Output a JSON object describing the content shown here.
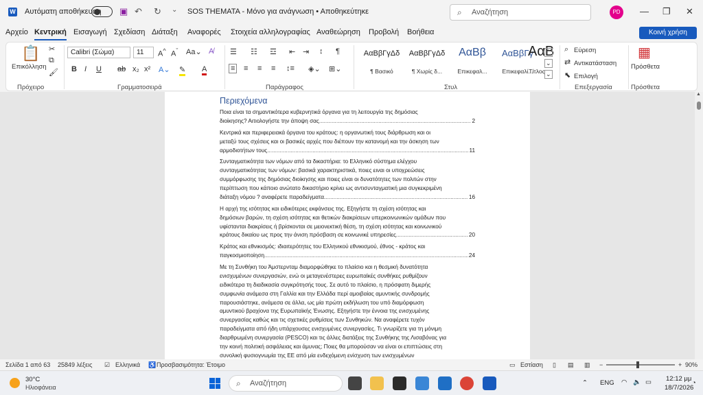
{
  "titlebar": {
    "app_icon": "W",
    "autosave_label": "Αυτόματη αποθήκευση",
    "doc_title": "SOS THEMATA  -  Μόνο για ανάγνωση  •  Αποθηκεύτηκε",
    "search_placeholder": "Αναζήτηση",
    "avatar_initials": "PD"
  },
  "menu": {
    "tabs": [
      "Αρχείο",
      "Κεντρική",
      "Εισαγωγή",
      "Σχεδίαση",
      "Διάταξη",
      "Αναφορές",
      "Στοιχεία αλληλογραφίας",
      "Αναθεώρηση",
      "Προβολή",
      "Βοήθεια"
    ],
    "share_label": "Κοινή χρήση"
  },
  "ribbon": {
    "paste_label": "Επικόλληση",
    "font_name": "Calibri (Σώμα)",
    "font_size": "11",
    "groups": [
      "Πρόχειρο",
      "Γραμματοσειρά",
      "Παράγραφος",
      "Στυλ",
      "Επεξεργασία",
      "Πρόσθετα"
    ],
    "styles": [
      {
        "sample": "ΑαΒβΓγΔδ",
        "name": "¶ Βασικό"
      },
      {
        "sample": "ΑαΒβΓγΔδ",
        "name": "¶ Χωρίς δ..."
      },
      {
        "sample": "ΑαΒβ",
        "name": "Επικεφαλ..."
      },
      {
        "sample": "ΑαΒβΓγ",
        "name": "Επικεφαλί..."
      },
      {
        "sample": "ΑαΒ",
        "name": "Τίτλος"
      }
    ],
    "find_label": "Εύρεση",
    "replace_label": "Αντικατάσταση",
    "select_label": "Επιλογή",
    "addins_label": "Πρόσθετα"
  },
  "document": {
    "toc_title": "Περιεχόμενα",
    "entries": [
      {
        "lines": [
          "Ποια είναι τα σημαντικότερα κυβερνητικά όργανα για τη λειτουργία της δημόσιας"
        ],
        "last": "διοίκησης? Αιτιολογήστε την άποψη σας ",
        "page": "2"
      },
      {
        "lines": [
          "Κεντρικά και περιφερειακά όργανα του κράτους: η οργανωτική τους διάρθρωση και οι",
          "μεταξύ τους σχέσεις και οι βασικές αρχές που διέπουν την κατανομή και την άσκηση των"
        ],
        "last": "αρμοδιοτήτων τους ",
        "page": "11"
      },
      {
        "lines": [
          "Συνταγματικότητα των νόμων από τα δικαστήρια: το Ελληνικό σύστημα ελέγχου",
          "συνταγματικότητας των νόμων: βασικά χαρακτηριστικά, ποιες ειναι οι υποχρεώσεις",
          "συμμόρφωσης της δημόσιας διοίκησης και ποιες είναι οι δυνατότητες των πολιτών στην",
          "περίπτωση που κάποιο ανώτατο δικαστήριο κρίνει ως αντισυνταγματική μια συγκεκριμένη"
        ],
        "last": "διάταξη νόμου ? αναφέρετε παραδείγματα. ",
        "page": "16"
      },
      {
        "lines": [
          "Η αρχή της ισότητας και ειδικότερες εκφάνσεις της. Εξηγήστε τη σχέση ισότητας και",
          "δημόσιων βαρών, τη σχέση ισότητας και θετικών διακρίσεων υπερκοινωνικών ομάδων που",
          "υφίστανται διακρίσεις ή βρίσκονται σε μειονεκτική θέση, τη σχέση ισότητας και κοινωνικού"
        ],
        "last": "κράτους δικαίου ως προς την άνιση πρόσβαση σε κοινωνικέ υπηρεσίες. ",
        "page": "20"
      },
      {
        "lines": [
          "Κράτος και εθνικισμός: ιδιαιτερότητες του Ελληνικού εθνικισμού, έθνος - κράτος και"
        ],
        "last": "παγκοσμιοποίηση",
        "page": "24"
      },
      {
        "lines": [
          "Με τη Συνθήκη του Άμστερνταμ διαμορφώθηκε το πλαίσιο και η θεσμική δυνατότητα",
          "ενισχυμένων συνεργασιών, ενώ οι μεταγενέστερες ευρωπαϊκές συνθήκες ρυθμίζουν",
          "ειδικότερα τη διαδικασία συγκρότησής τους. Σε αυτό το πλαίσιο, η πρόσφατη διμερής",
          "συμφωνία ανάμεσα στη Γαλλία και την Ελλάδα περί αμοιβαίας αμυντικής συνδρομής",
          "παρουσιάστηκε, ανάμεσα σε άλλα, ως μία πρώτη εκδήλωση του υπό διαμόρφωση",
          "αμυντικού βραχίονα της Ευρωπαϊκής Ένωσης. Εξηγήστε την έννοια της ενισχυμένης",
          "συνεργασίας καθώς και τις σχετικές ρυθμίσεις των Συνθηκών. Να αναφέρετε τυχόν",
          "παραδείγματα από ήδη υπάρχουσες ενισχυμένες συνεργασίες. Τι γνωρίζετε για τη μόνιμη",
          "διαρθρωμένη συνεργασία (PESCO) και τις άλλες διατάξεις της Συνθήκης της Λισαβόνας για",
          "την κοινή πολιτική ασφάλειας και άμυνας; Ποιες θα μπορούσαν να είναι οι επιπτώσεις στη",
          "συνολική φυσιογνωμία της ΕΕ από μία ενδεχόμενη ενίσχυση των ενισχυμένων"
        ],
        "last": "",
        "page": ""
      }
    ]
  },
  "status": {
    "page": "Σελίδα 1 από 63",
    "words": "25849 λέξεις",
    "language": "Ελληνικά",
    "accessibility": "Προσβασιμότητα: Έτοιμο",
    "focus": "Εστίαση",
    "zoom": "90%"
  },
  "taskbar": {
    "temp": "30°C",
    "weather": "Ηλιοφάνεια",
    "search_placeholder": "Αναζήτηση",
    "lang": "ENG",
    "time": "12:12 μμ",
    "date": "18/7/2026"
  }
}
